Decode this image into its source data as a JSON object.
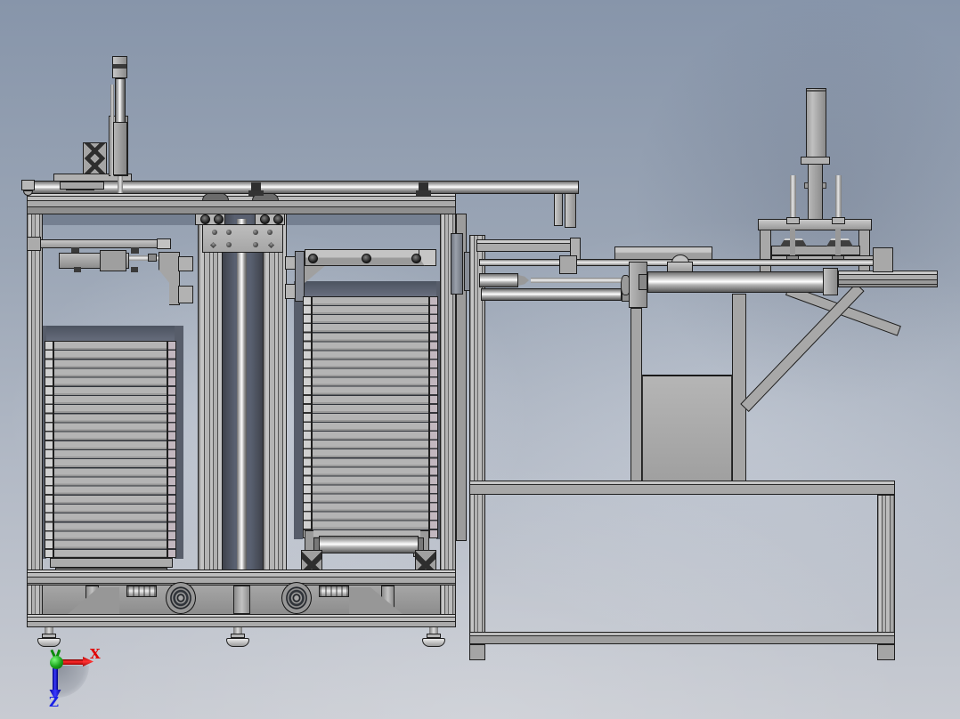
{
  "triad": {
    "x_label": "X",
    "z_label": "Z"
  },
  "colors": {
    "bg_top": "#8795aa",
    "bg_mid": "#9aa5b5",
    "bg_bottom": "#c8cbd2",
    "part": "#ababab",
    "part_light": "#c9c9c9",
    "part_dark": "#8d8d8d",
    "edge": "#1f1f1f",
    "cavity": "#596070",
    "x_axis": "#e10000",
    "z_axis": "#1a22e6",
    "origin": "#17a017"
  }
}
